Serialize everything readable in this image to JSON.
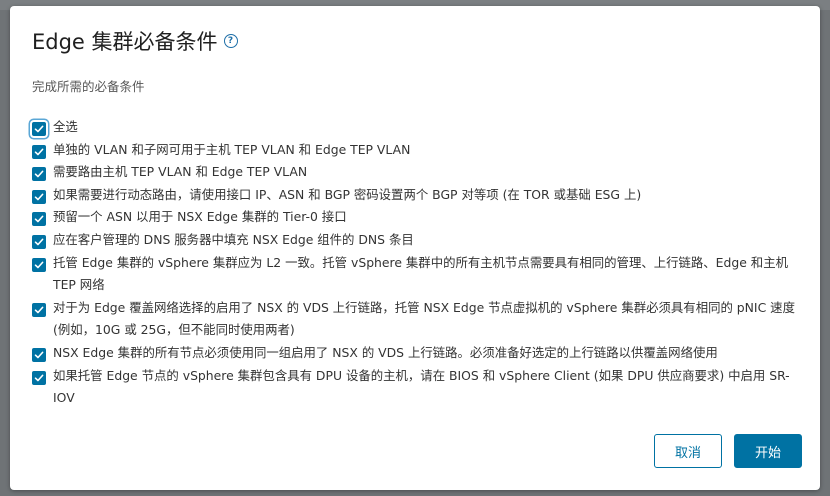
{
  "dialog": {
    "title": "Edge 集群必备条件",
    "help_icon": "help-circle-icon",
    "subtitle": "完成所需的必备条件"
  },
  "checklist": {
    "select_all": {
      "label": "全选",
      "checked": true
    },
    "items": [
      {
        "label": "单独的 VLAN 和子网可用于主机 TEP VLAN 和 Edge TEP VLAN",
        "checked": true
      },
      {
        "label": "需要路由主机 TEP VLAN 和 Edge TEP VLAN",
        "checked": true
      },
      {
        "label": "如果需要进行动态路由，请使用接口 IP、ASN 和 BGP 密码设置两个 BGP 对等项 (在 TOR 或基础 ESG 上)",
        "checked": true
      },
      {
        "label": "预留一个 ASN 以用于 NSX Edge 集群的 Tier-0 接口",
        "checked": true
      },
      {
        "label": "应在客户管理的 DNS 服务器中填充 NSX Edge 组件的 DNS 条目",
        "checked": true
      },
      {
        "label": "托管 Edge 集群的 vSphere 集群应为 L2 一致。托管 vSphere 集群中的所有主机节点需要具有相同的管理、上行链路、Edge 和主机 TEP 网络",
        "checked": true
      },
      {
        "label": "对于为 Edge 覆盖网络选择的启用了 NSX 的 VDS 上行链路，托管 NSX Edge 节点虚拟机的 vSphere 集群必须具有相同的 pNIC 速度 (例如，10G 或 25G，但不能同时使用两者)",
        "checked": true
      },
      {
        "label": "NSX Edge 集群的所有节点必须使用同一组启用了 NSX 的 VDS 上行链路。必须准备好选定的上行链路以供覆盖网络使用",
        "checked": true
      },
      {
        "label": "如果托管 Edge 节点的 vSphere 集群包含具有 DPU 设备的主机，请在 BIOS 和 vSphere Client (如果 DPU 供应商要求) 中启用 SR-IOV",
        "checked": true
      }
    ]
  },
  "footer": {
    "cancel_label": "取消",
    "start_label": "开始"
  },
  "colors": {
    "accent": "#0072a3",
    "backdrop": "#6f7376"
  }
}
